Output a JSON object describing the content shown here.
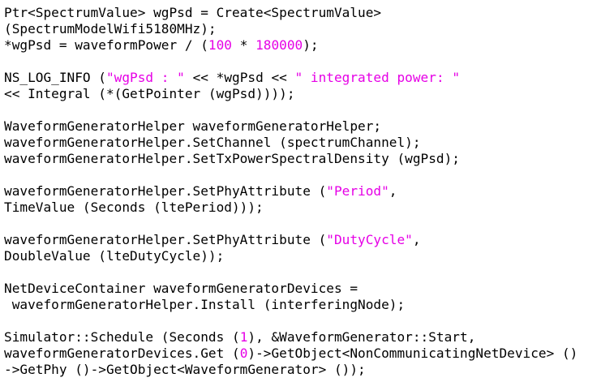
{
  "code": {
    "lines": [
      [
        {
          "t": "plain",
          "s": "Ptr<SpectrumValue> wgPsd = Create<SpectrumValue>"
        }
      ],
      [
        {
          "t": "plain",
          "s": "(SpectrumModelWifi5180MHz);"
        }
      ],
      [
        {
          "t": "plain",
          "s": "*wgPsd = waveformPower / ("
        },
        {
          "t": "number",
          "s": "100"
        },
        {
          "t": "plain",
          "s": " * "
        },
        {
          "t": "number",
          "s": "180000"
        },
        {
          "t": "plain",
          "s": ");"
        }
      ],
      [],
      [
        {
          "t": "plain",
          "s": "NS_LOG_INFO ("
        },
        {
          "t": "string",
          "s": "\"wgPsd : \""
        },
        {
          "t": "plain",
          "s": " << *wgPsd << "
        },
        {
          "t": "string",
          "s": "\" integrated power: \""
        }
      ],
      [
        {
          "t": "plain",
          "s": "<< Integral (*(GetPointer (wgPsd))));"
        }
      ],
      [],
      [
        {
          "t": "plain",
          "s": "WaveformGeneratorHelper waveformGeneratorHelper;"
        }
      ],
      [
        {
          "t": "plain",
          "s": "waveformGeneratorHelper.SetChannel (spectrumChannel);"
        }
      ],
      [
        {
          "t": "plain",
          "s": "waveformGeneratorHelper.SetTxPowerSpectralDensity (wgPsd);"
        }
      ],
      [],
      [
        {
          "t": "plain",
          "s": "waveformGeneratorHelper.SetPhyAttribute ("
        },
        {
          "t": "string",
          "s": "\"Period\""
        },
        {
          "t": "plain",
          "s": ","
        }
      ],
      [
        {
          "t": "plain",
          "s": "TimeValue (Seconds (ltePeriod)));"
        }
      ],
      [],
      [
        {
          "t": "plain",
          "s": "waveformGeneratorHelper.SetPhyAttribute ("
        },
        {
          "t": "string",
          "s": "\"DutyCycle\""
        },
        {
          "t": "plain",
          "s": ","
        }
      ],
      [
        {
          "t": "plain",
          "s": "DoubleValue (lteDutyCycle));"
        }
      ],
      [],
      [
        {
          "t": "plain",
          "s": "NetDeviceContainer waveformGeneratorDevices ="
        }
      ],
      [
        {
          "t": "plain",
          "s": " waveformGeneratorHelper.Install (interferingNode);"
        }
      ],
      [],
      [
        {
          "t": "plain",
          "s": "Simulator::Schedule (Seconds ("
        },
        {
          "t": "number",
          "s": "1"
        },
        {
          "t": "plain",
          "s": "), &WaveformGenerator::Start,"
        }
      ],
      [
        {
          "t": "plain",
          "s": "waveformGeneratorDevices.Get ("
        },
        {
          "t": "number",
          "s": "0"
        },
        {
          "t": "plain",
          "s": ")->GetObject<NonCommunicatingNetDevice> ()"
        }
      ],
      [
        {
          "t": "plain",
          "s": "->GetPhy ()->GetObject<WaveformGenerator> ());"
        }
      ]
    ]
  },
  "colors": {
    "background": "#ffffff",
    "text": "#000000",
    "literal": "#e600e6"
  }
}
